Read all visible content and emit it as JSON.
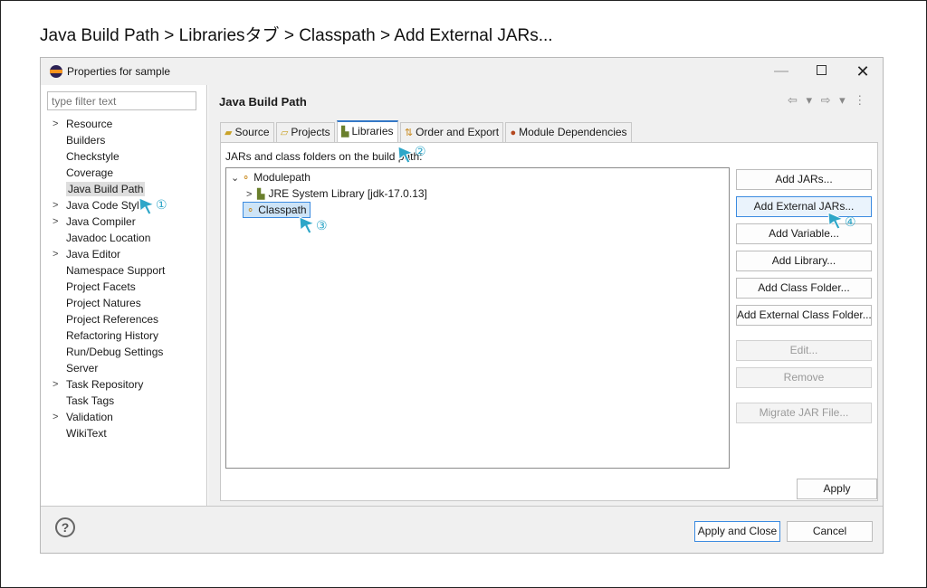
{
  "caption": "Java Build Path > Librariesタブ > Classpath > Add External JARs...",
  "window": {
    "title": "Properties for sample",
    "minimize": "—",
    "close": "✕"
  },
  "sidebar": {
    "filter_placeholder": "type filter text",
    "items": [
      {
        "label": "Resource",
        "expandable": true
      },
      {
        "label": "Builders",
        "expandable": false
      },
      {
        "label": "Checkstyle",
        "expandable": false
      },
      {
        "label": "Coverage",
        "expandable": false
      },
      {
        "label": "Java Build Path",
        "expandable": false,
        "selected": true
      },
      {
        "label": "Java Code Style",
        "expandable": true
      },
      {
        "label": "Java Compiler",
        "expandable": true
      },
      {
        "label": "Javadoc Location",
        "expandable": false
      },
      {
        "label": "Java Editor",
        "expandable": true
      },
      {
        "label": "Namespace Support",
        "expandable": false
      },
      {
        "label": "Project Facets",
        "expandable": false
      },
      {
        "label": "Project Natures",
        "expandable": false
      },
      {
        "label": "Project References",
        "expandable": false
      },
      {
        "label": "Refactoring History",
        "expandable": false
      },
      {
        "label": "Run/Debug Settings",
        "expandable": false
      },
      {
        "label": "Server",
        "expandable": false
      },
      {
        "label": "Task Repository",
        "expandable": true
      },
      {
        "label": "Task Tags",
        "expandable": false
      },
      {
        "label": "Validation",
        "expandable": true
      },
      {
        "label": "WikiText",
        "expandable": false
      }
    ]
  },
  "content": {
    "title": "Java Build Path",
    "nav": "⇦ ▾ ⇨ ▾ ⋮",
    "tabs": [
      "Source",
      "Projects",
      "Libraries",
      "Order and Export",
      "Module Dependencies"
    ],
    "active_tab": "Libraries",
    "description": "JARs and class folders on the build path:",
    "tree": {
      "modulepath": "Modulepath",
      "jre": "JRE System Library [jdk-17.0.13]",
      "classpath": "Classpath"
    },
    "buttons": [
      "Add JARs...",
      "Add External JARs...",
      "Add Variable...",
      "Add Library...",
      "Add Class Folder...",
      "Add External Class Folder...",
      "Edit...",
      "Remove",
      "Migrate JAR File..."
    ],
    "apply": "Apply"
  },
  "footer": {
    "help": "?",
    "apply_close": "Apply and Close",
    "cancel": "Cancel"
  },
  "steps": [
    "①",
    "②",
    "③",
    "④"
  ],
  "colors": {
    "cursor": "#2ea6c8",
    "selection": "#cde4f7",
    "focus_border": "#3c8be0"
  }
}
